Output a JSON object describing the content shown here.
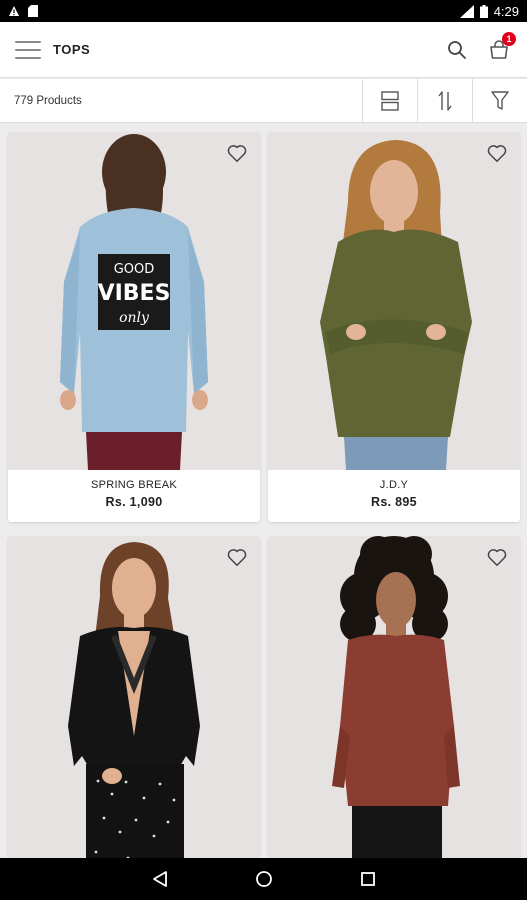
{
  "status_bar": {
    "time": "4:29"
  },
  "header": {
    "title": "TOPS",
    "cart_count": "1"
  },
  "toolbar": {
    "product_count": "779 Products"
  },
  "products": [
    {
      "brand": "SPRING BREAK",
      "price": "Rs. 1,090",
      "print_line1": "GOOD",
      "print_line2": "VIBES",
      "print_line3": "only"
    },
    {
      "brand": "J.D.Y",
      "price": "Rs. 895"
    },
    {
      "brand": "",
      "price": ""
    },
    {
      "brand": "",
      "price": ""
    }
  ],
  "colors": {
    "accent": "#e0001b",
    "card_bg": "#e7e2e2",
    "page_bg": "#ececec"
  },
  "icons": [
    "menu-icon",
    "search-icon",
    "cart-icon",
    "view-toggle-icon",
    "sort-icon",
    "filter-icon",
    "heart-icon",
    "back-icon",
    "home-icon",
    "recents-icon"
  ]
}
